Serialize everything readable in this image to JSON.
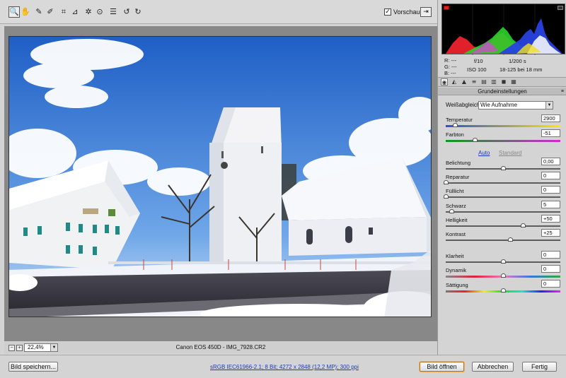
{
  "app": {
    "toolbar": {
      "tools": [
        {
          "name": "zoom-tool",
          "glyph": "🔍"
        },
        {
          "name": "hand-tool",
          "glyph": "✋"
        },
        {
          "name": "white-balance-tool",
          "glyph": "✎"
        },
        {
          "name": "color-sampler-tool",
          "glyph": "✐"
        },
        {
          "name": "crop-tool",
          "glyph": "⌗"
        },
        {
          "name": "straighten-tool",
          "glyph": "⊿"
        },
        {
          "name": "retouch-tool",
          "glyph": "✲"
        },
        {
          "name": "red-eye-tool",
          "glyph": "⊙"
        },
        {
          "name": "preferences-tool",
          "glyph": "☰"
        },
        {
          "name": "rotate-left-tool",
          "glyph": "↺"
        },
        {
          "name": "rotate-right-tool",
          "glyph": "↻"
        }
      ],
      "preview_label": "Vorschau",
      "preview_checked": "✓",
      "fullscreen_glyph": "⇥"
    },
    "status": {
      "zoom_minus": "−",
      "zoom_plus": "+",
      "zoom_value": "22,4%",
      "zoom_arrow": "▼",
      "camera_info": "Canon EOS 450D - IMG_7928.CR2"
    },
    "bottom": {
      "save_label": "Bild speichern...",
      "workflow_link": "sRGB IEC61966-2.1; 8 Bit; 4272 x 2848 (12,2 MP); 300 ppi",
      "open_label": "Bild öffnen",
      "cancel_label": "Abbrechen",
      "done_label": "Fertig"
    }
  },
  "panel": {
    "readout": {
      "r": "R:   ---",
      "g": "G:   ---",
      "b": "B:   ---"
    },
    "camera": {
      "aperture": "f/10",
      "shutter": "1/200 s",
      "iso": "ISO 100",
      "lens": "18-125 bei 18 mm"
    },
    "tabs": [
      "◉",
      "◭",
      "▲",
      "≡",
      "▤",
      "▥",
      "◼",
      "▦"
    ],
    "section_title": "Grundeinstellungen",
    "section_menu": "≡",
    "wb_label": "Weißabgleich:",
    "wb_value": "Wie Aufnahme",
    "wb_arrow": "▼",
    "auto_label": "Auto",
    "standard_label": "Standard",
    "sliders": [
      {
        "key": "temp",
        "label": "Temperatur",
        "value": "2900",
        "level": 0.08
      },
      {
        "key": "tint",
        "label": "Farbton",
        "value": "-51",
        "level": 0.25
      },
      {
        "key": "exp",
        "label": "Belichtung",
        "value": "0,00",
        "level": 0.5
      },
      {
        "key": "rec",
        "label": "Reparatur",
        "value": "0",
        "level": 0.0
      },
      {
        "key": "fill",
        "label": "Fülllicht",
        "value": "0",
        "level": 0.0
      },
      {
        "key": "blk",
        "label": "Schwarz",
        "value": "5",
        "level": 0.05
      },
      {
        "key": "bri",
        "label": "Helligkeit",
        "value": "+50",
        "level": 0.67
      },
      {
        "key": "con",
        "label": "Kontrast",
        "value": "+25",
        "level": 0.56
      },
      {
        "key": "clar",
        "label": "Klarheit",
        "value": "0",
        "level": 0.5
      },
      {
        "key": "vib",
        "label": "Dynamik",
        "value": "0",
        "level": 0.5
      },
      {
        "key": "sat",
        "label": "Sättigung",
        "value": "0",
        "level": 0.5
      }
    ]
  }
}
